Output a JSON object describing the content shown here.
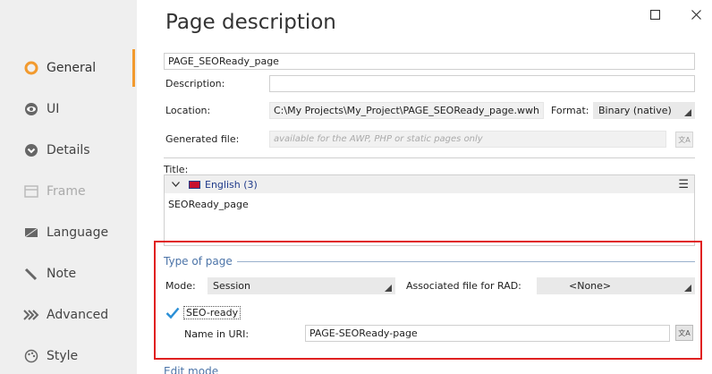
{
  "sidebar": {
    "items": [
      {
        "label": "General",
        "icon": "circle-ring-icon",
        "state": "active"
      },
      {
        "label": "UI",
        "icon": "eye-icon",
        "state": "normal"
      },
      {
        "label": "Details",
        "icon": "chevron-circle-icon",
        "state": "normal"
      },
      {
        "label": "Frame",
        "icon": "frame-icon",
        "state": "disabled"
      },
      {
        "label": "Language",
        "icon": "flag-icon",
        "state": "normal"
      },
      {
        "label": "Note",
        "icon": "pencil-icon",
        "state": "normal"
      },
      {
        "label": "Advanced",
        "icon": "double-chevron-icon",
        "state": "normal"
      },
      {
        "label": "Style",
        "icon": "palette-icon",
        "state": "normal"
      }
    ],
    "accent_color": "#f29a2e"
  },
  "header": {
    "title": "Page description"
  },
  "form": {
    "name_value": "PAGE_SEOReady_page",
    "description_label": "Description:",
    "description_value": "",
    "location_label": "Location:",
    "location_value": "C:\\My Projects\\My_Project\\PAGE_SEOReady_page.wwh",
    "format_label": "Format:",
    "format_value": "Binary (native)",
    "generated_label": "Generated file:",
    "generated_placeholder": "available for the AWP, PHP or static pages only",
    "title_label": "Title:",
    "lang_label": "English (3)",
    "title_value": "SEOReady_page"
  },
  "type_of_page": {
    "group_title": "Type of page",
    "mode_label": "Mode:",
    "mode_value": "Session",
    "rad_label": "Associated file for RAD:",
    "rad_value": "<None>",
    "seo_label": "SEO-ready",
    "seo_checked": true,
    "uri_label": "Name in URI:",
    "uri_value": "PAGE-SEOReady-page"
  },
  "edit_mode": {
    "group_title": "Edit mode"
  },
  "colors": {
    "highlight": "#e02020",
    "group_title": "#4c74a8",
    "check": "#2a8fd6"
  }
}
